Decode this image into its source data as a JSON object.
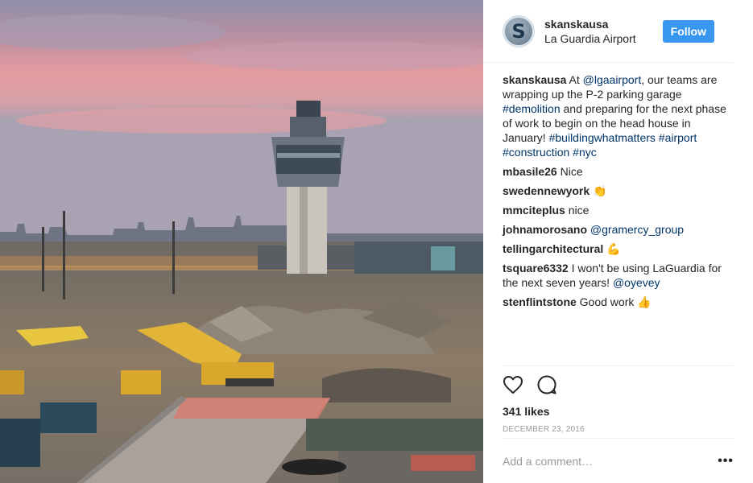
{
  "post": {
    "image_alt": "Construction site demolition at LaGuardia Airport with control tower at sunset",
    "header": {
      "avatar_letter": "S",
      "username": "skanskausa",
      "location": "La Guardia Airport",
      "follow_label": "Follow"
    },
    "caption": {
      "user": "skanskausa",
      "t1": " At ",
      "l1": "@lgaairport",
      "t2": ", our teams are wrapping up the P-2 parking garage ",
      "l2": "#demolition",
      "t3": " and preparing for the next phase of work to begin on the head house in January! ",
      "l3": "#buildingwhatmatters",
      "t4": " ",
      "l4": "#airport",
      "t5": " ",
      "l5": "#construction",
      "t6": " ",
      "l6": "#nyc"
    },
    "comments": [
      {
        "user": "mbasile26",
        "text": " Nice",
        "link": "",
        "emoji": ""
      },
      {
        "user": "swedennewyork",
        "text": " ",
        "link": "",
        "emoji": "👏"
      },
      {
        "user": "mmciteplus",
        "text": " nice",
        "link": "",
        "emoji": ""
      },
      {
        "user": "johnamorosano",
        "text": " ",
        "link": "@gramercy_group",
        "emoji": ""
      },
      {
        "user": "tellingarchitectural",
        "text": " ",
        "link": "",
        "emoji": "💪"
      },
      {
        "user": "tsquare6332",
        "text": " I won't be using LaGuardia for the next seven years! ",
        "link": "@oyevey",
        "emoji": ""
      },
      {
        "user": "stenflintstone",
        "text": " Good work ",
        "link": "",
        "emoji": "👍"
      }
    ],
    "icons": {
      "like": "heart-icon",
      "comment": "comment-bubble-icon",
      "more": "more-options-icon"
    },
    "likes": "341 likes",
    "date": "December 23, 2016",
    "add_comment_placeholder": "Add a comment…",
    "more_label": "•••",
    "colors": {
      "follow": "#3897f0",
      "link": "#003569",
      "border": "#efefef",
      "muted": "#999999"
    }
  }
}
